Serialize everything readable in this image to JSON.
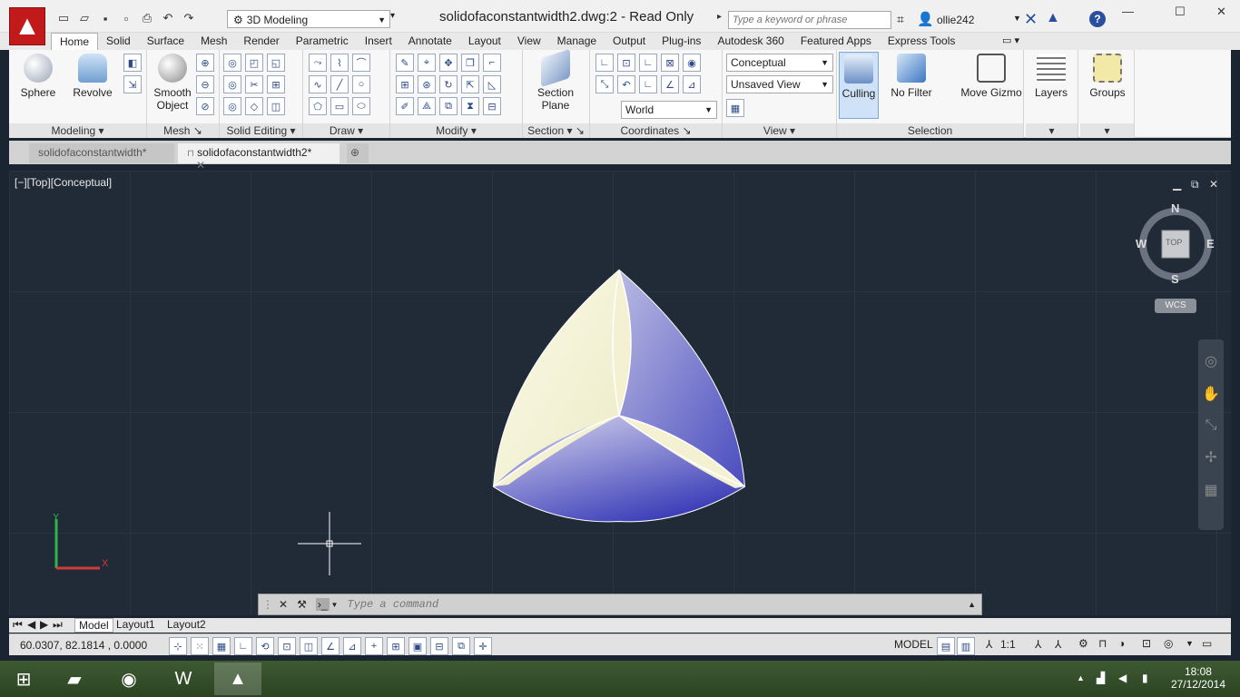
{
  "titlebar": {
    "title": "solidofaconstantwidth2.dwg:2 - Read Only",
    "workspace": "3D Modeling",
    "search_placeholder": "Type a keyword or phrase",
    "user": "ollie242"
  },
  "ribbon": {
    "tabs": [
      "Home",
      "Solid",
      "Surface",
      "Mesh",
      "Render",
      "Parametric",
      "Insert",
      "Annotate",
      "Layout",
      "View",
      "Manage",
      "Output",
      "Plug-ins",
      "Autodesk 360",
      "Featured Apps",
      "Express Tools"
    ],
    "active_tab": "Home",
    "buttons": {
      "sphere": "Sphere",
      "revolve": "Revolve",
      "smooth_object": "Smooth Object",
      "section_plane": "Section Plane",
      "culling": "Culling",
      "no_filter": "No Filter",
      "move_gizmo": "Move Gizmo",
      "layers": "Layers",
      "groups": "Groups"
    },
    "panels": {
      "modeling": "Modeling",
      "mesh": "Mesh",
      "solid_editing": "Solid Editing",
      "draw": "Draw",
      "modify": "Modify",
      "section": "Section",
      "coordinates": "Coordinates",
      "view": "View",
      "selection": "Selection"
    },
    "dropdowns": {
      "visual_style": "Conceptual",
      "named_view": "Unsaved View",
      "ucs": "World"
    }
  },
  "doc_tabs": [
    {
      "label": "solidofaconstantwidth*"
    },
    {
      "label": "solidofaconstantwidth2*"
    }
  ],
  "viewport": {
    "label": "[−][Top][Conceptual]",
    "viewcube": {
      "n": "N",
      "s": "S",
      "e": "E",
      "w": "W",
      "top": "TOP",
      "wcs": "WCS"
    },
    "colors": {
      "light_face": "#f6f5d8",
      "dark_face": "#4a4cbf",
      "background": "#212b38"
    }
  },
  "command": {
    "placeholder": "Type a command"
  },
  "layout_tabs": [
    "Model",
    "Layout1",
    "Layout2"
  ],
  "status": {
    "coords": "60.0307, 82.1814 , 0.0000",
    "model": "MODEL",
    "scale": "1:1"
  },
  "taskbar": {
    "time": "18:08",
    "date": "27/12/2014"
  }
}
